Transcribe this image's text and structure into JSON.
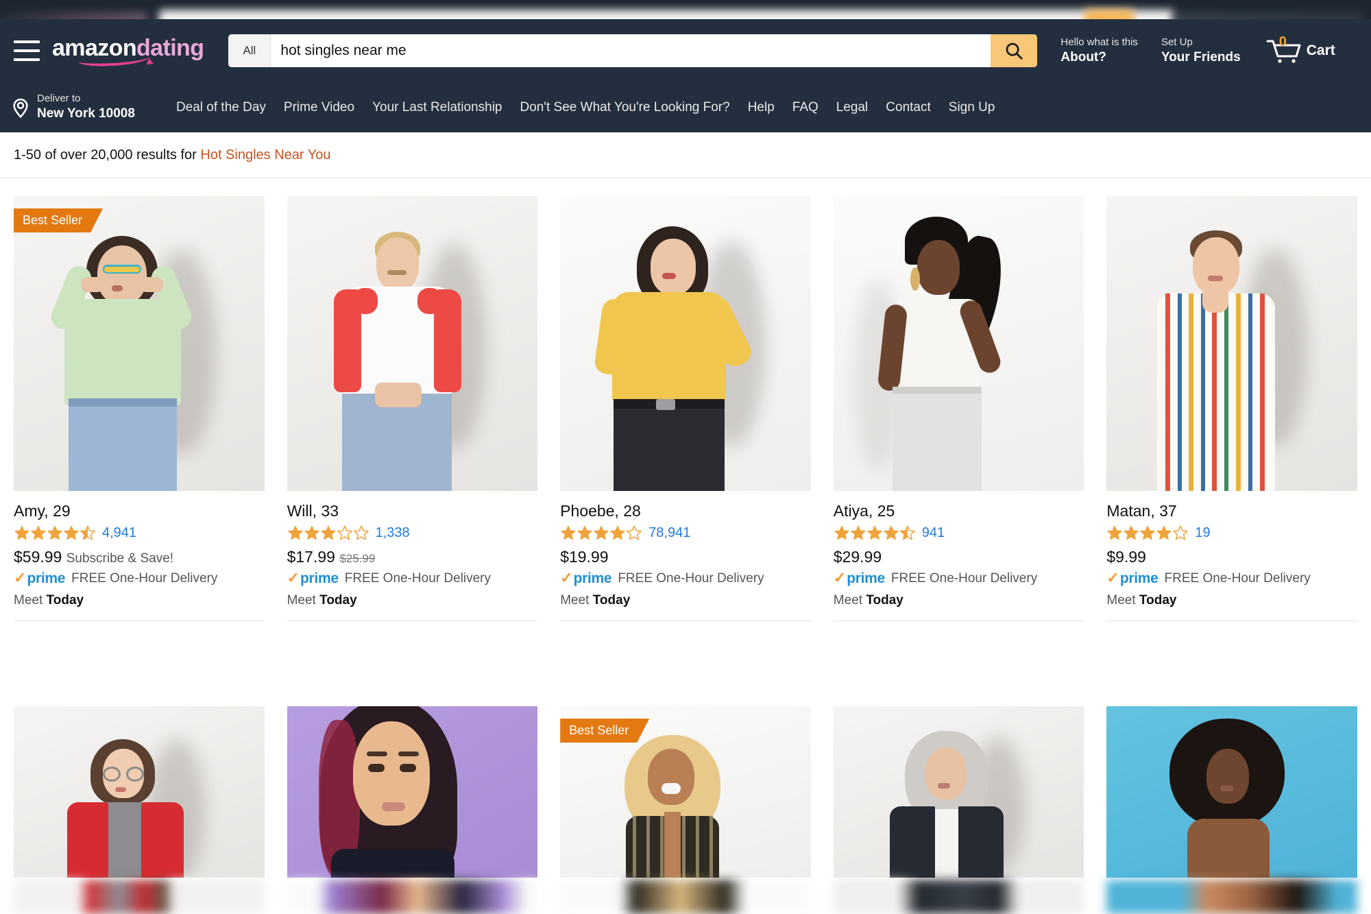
{
  "header": {
    "logo_primary": "amazon",
    "logo_secondary": "dating",
    "menu_icon": "hamburger-menu-icon",
    "search": {
      "category": "All",
      "value": "hot singles near me",
      "placeholder": "Search",
      "button_icon": "search-icon"
    },
    "about": {
      "line1": "Hello what is this",
      "line2": "About?"
    },
    "friends": {
      "line1": "Set Up",
      "line2": "Your Friends"
    },
    "cart": {
      "count": "0",
      "label": "Cart",
      "icon": "shopping-cart-icon"
    },
    "deliver": {
      "line1": "Deliver to",
      "line2": "New York 10008",
      "icon": "location-pin-icon"
    },
    "nav_links": [
      "Deal of the Day",
      "Prime Video",
      "Your Last Relationship",
      "Don't See What You're Looking For?",
      "Help",
      "FAQ",
      "Legal",
      "Contact",
      "Sign Up"
    ]
  },
  "results": {
    "prefix": "1-50 of over 20,000 results for ",
    "query": "Hot Singles Near You"
  },
  "labels": {
    "badge_best_seller": "Best Seller",
    "prime": "prime",
    "shipping": "FREE One-Hour Delivery",
    "meet_prefix": "Meet ",
    "meet_value": "Today",
    "subscribe_save": "Subscribe & Save!"
  },
  "colors": {
    "header_bg": "#232f3e",
    "accent_orange": "#e47911",
    "search_button": "#f8c777",
    "link_blue": "#1f7ae0",
    "prime_blue": "#1f8ed6",
    "query_orange": "#c7511f",
    "logo_pink": "#e9a7d8",
    "swoosh_pink": "#e4408f",
    "star_gold": "#f0a33a"
  },
  "row1": [
    {
      "name": "Amy, 29",
      "stars": 4.5,
      "reviews": "4,941",
      "price": "$59.99",
      "price_note": "Subscribe & Save!",
      "old_price": "",
      "shipping": "FREE One-Hour Delivery",
      "meet": "Today",
      "badge": "Best Seller",
      "photo": "woman-green-cardigan-sunglasses"
    },
    {
      "name": "Will, 33",
      "stars": 3,
      "reviews": "1,338",
      "price": "$17.99",
      "price_note": "",
      "old_price": "$25.99",
      "shipping": "FREE One-Hour Delivery",
      "meet": "Today",
      "badge": "",
      "photo": "man-red-raglan-shirt"
    },
    {
      "name": "Phoebe, 28",
      "stars": 4,
      "reviews": "78,941",
      "price": "$19.99",
      "price_note": "",
      "old_price": "",
      "shipping": "FREE One-Hour Delivery",
      "meet": "Today",
      "badge": "",
      "photo": "woman-yellow-sweater"
    },
    {
      "name": "Atiya, 25",
      "stars": 4.5,
      "reviews": "941",
      "price": "$29.99",
      "price_note": "",
      "old_price": "",
      "shipping": "FREE One-Hour Delivery",
      "meet": "Today",
      "badge": "",
      "photo": "woman-white-crop-top-braids"
    },
    {
      "name": "Matan, 37",
      "stars": 4,
      "reviews": "19",
      "price": "$9.99",
      "price_note": "",
      "old_price": "",
      "shipping": "FREE One-Hour Delivery",
      "meet": "Today",
      "badge": "",
      "photo": "man-striped-shirt"
    }
  ],
  "row2": [
    {
      "badge": "",
      "photo": "woman-red-blazer-glasses"
    },
    {
      "badge": "",
      "photo": "woman-purple-backdrop-portrait"
    },
    {
      "badge": "Best Seller",
      "photo": "woman-blonde-curly-laughing"
    },
    {
      "badge": "",
      "photo": "woman-grey-hair-denim-jacket"
    },
    {
      "badge": "",
      "photo": "woman-afro-blue-backdrop"
    }
  ]
}
